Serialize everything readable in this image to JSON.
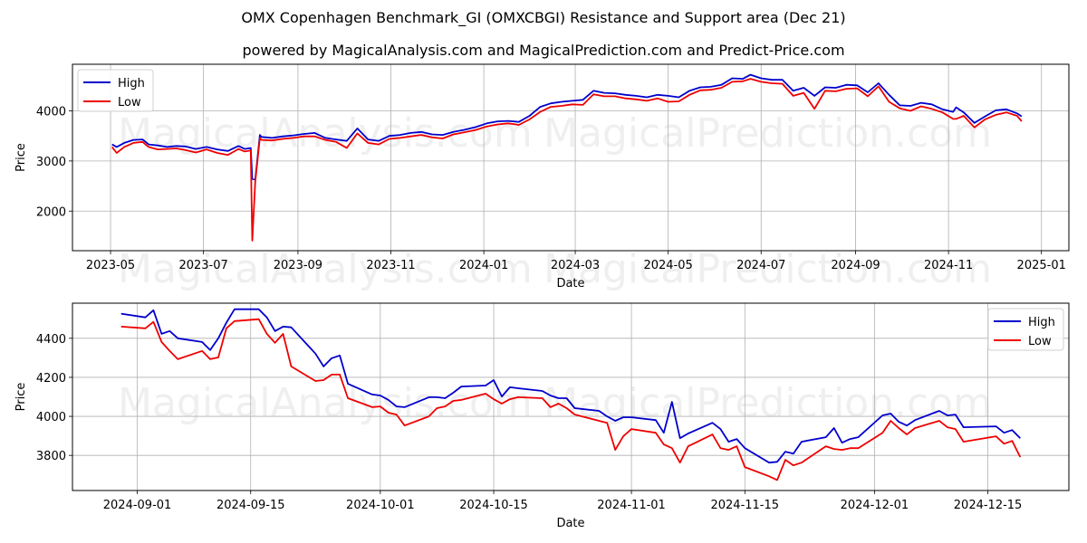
{
  "header": {
    "title": "OMX Copenhagen Benchmark_GI (OMXCBGI) Resistance and Support area (Dec 21)",
    "subtitle": "powered by MagicalAnalysis.com and MagicalPrediction.com and Predict-Price.com"
  },
  "watermarks": [
    "MagicalAnalysis.com",
    "MagicalPrediction.com"
  ],
  "colors": {
    "high": "#0000cc",
    "low": "#ee0000",
    "grid": "#b0b0b0"
  },
  "chart_data": [
    {
      "type": "line",
      "title": "",
      "xlabel": "Date",
      "ylabel": "Price",
      "ylim": [
        1210,
        4930
      ],
      "xlim": [
        "2023-04-06",
        "2025-01-19"
      ],
      "grid": true,
      "legend": {
        "placement": "top-left",
        "entries": [
          "High",
          "Low"
        ]
      },
      "x_ticks": [
        "2023-05",
        "2023-07",
        "2023-09",
        "2023-11",
        "2024-01",
        "2024-03",
        "2024-05",
        "2024-07",
        "2024-09",
        "2024-11",
        "2025-01"
      ],
      "y_ticks": [
        2000,
        3000,
        4000
      ],
      "x": [
        "2023-05-02",
        "2023-05-05",
        "2023-05-10",
        "2023-05-16",
        "2023-05-22",
        "2023-05-26",
        "2023-06-01",
        "2023-06-07",
        "2023-06-13",
        "2023-06-19",
        "2023-06-26",
        "2023-07-03",
        "2023-07-10",
        "2023-07-17",
        "2023-07-24",
        "2023-07-28",
        "2023-08-01",
        "2023-08-02",
        "2023-08-04",
        "2023-08-07",
        "2023-08-08",
        "2023-08-15",
        "2023-08-22",
        "2023-08-29",
        "2023-09-05",
        "2023-09-12",
        "2023-09-19",
        "2023-09-26",
        "2023-10-03",
        "2023-10-10",
        "2023-10-17",
        "2023-10-24",
        "2023-10-31",
        "2023-11-07",
        "2023-11-14",
        "2023-11-21",
        "2023-11-28",
        "2023-12-05",
        "2023-12-12",
        "2023-12-19",
        "2023-12-27",
        "2024-01-03",
        "2024-01-10",
        "2024-01-17",
        "2024-01-24",
        "2024-01-31",
        "2024-02-07",
        "2024-02-14",
        "2024-02-21",
        "2024-02-28",
        "2024-03-06",
        "2024-03-13",
        "2024-03-20",
        "2024-03-27",
        "2024-04-03",
        "2024-04-10",
        "2024-04-17",
        "2024-04-24",
        "2024-05-01",
        "2024-05-08",
        "2024-05-15",
        "2024-05-22",
        "2024-05-29",
        "2024-06-05",
        "2024-06-12",
        "2024-06-19",
        "2024-06-24",
        "2024-07-01",
        "2024-07-08",
        "2024-07-15",
        "2024-07-22",
        "2024-07-29",
        "2024-08-05",
        "2024-08-12",
        "2024-08-19",
        "2024-08-26",
        "2024-09-02",
        "2024-09-09",
        "2024-09-16",
        "2024-09-23",
        "2024-09-30",
        "2024-10-07",
        "2024-10-14",
        "2024-10-21",
        "2024-10-28",
        "2024-11-04",
        "2024-11-06",
        "2024-11-11",
        "2024-11-18",
        "2024-11-25",
        "2024-12-02",
        "2024-12-09",
        "2024-12-16",
        "2024-12-19"
      ],
      "series": [
        {
          "name": "High",
          "values": [
            3330,
            3280,
            3360,
            3420,
            3430,
            3330,
            3310,
            3280,
            3300,
            3290,
            3240,
            3280,
            3230,
            3200,
            3300,
            3240,
            3260,
            2640,
            2630,
            3520,
            3480,
            3460,
            3490,
            3510,
            3540,
            3560,
            3460,
            3430,
            3400,
            3650,
            3430,
            3400,
            3500,
            3520,
            3560,
            3580,
            3530,
            3520,
            3580,
            3620,
            3680,
            3750,
            3790,
            3800,
            3780,
            3900,
            4080,
            4150,
            4180,
            4200,
            4220,
            4400,
            4360,
            4350,
            4320,
            4300,
            4270,
            4320,
            4300,
            4270,
            4400,
            4470,
            4480,
            4520,
            4650,
            4640,
            4720,
            4650,
            4620,
            4620,
            4400,
            4460,
            4300,
            4470,
            4460,
            4520,
            4510,
            4370,
            4550,
            4320,
            4110,
            4100,
            4160,
            4130,
            4030,
            3980,
            4070,
            3970,
            3760,
            3890,
            4010,
            4030,
            3950,
            3890
          ]
        },
        {
          "name": "Low",
          "values": [
            3280,
            3160,
            3280,
            3360,
            3380,
            3280,
            3230,
            3240,
            3250,
            3220,
            3170,
            3230,
            3160,
            3120,
            3240,
            3190,
            3210,
            1410,
            2590,
            3460,
            3420,
            3410,
            3440,
            3460,
            3490,
            3490,
            3420,
            3380,
            3260,
            3550,
            3360,
            3330,
            3440,
            3460,
            3490,
            3520,
            3470,
            3450,
            3530,
            3570,
            3620,
            3690,
            3730,
            3750,
            3720,
            3830,
            3980,
            4080,
            4100,
            4130,
            4120,
            4330,
            4290,
            4290,
            4250,
            4230,
            4200,
            4250,
            4180,
            4190,
            4320,
            4410,
            4420,
            4460,
            4580,
            4590,
            4640,
            4580,
            4550,
            4540,
            4300,
            4360,
            4040,
            4400,
            4390,
            4440,
            4450,
            4290,
            4490,
            4180,
            4050,
            4000,
            4090,
            4040,
            3970,
            3840,
            3840,
            3900,
            3670,
            3830,
            3920,
            3970,
            3900,
            3790
          ]
        }
      ]
    },
    {
      "type": "line",
      "title": "",
      "xlabel": "Date",
      "ylabel": "Price",
      "ylim": [
        3620,
        4580
      ],
      "xlim": [
        "2024-08-24",
        "2024-12-25"
      ],
      "grid": true,
      "legend": {
        "placement": "top-right",
        "entries": [
          "High",
          "Low"
        ]
      },
      "x_ticks": [
        "2024-09-01",
        "2024-09-15",
        "2024-10-01",
        "2024-10-15",
        "2024-11-01",
        "2024-11-15",
        "2024-12-01",
        "2024-12-15"
      ],
      "y_ticks": [
        3800,
        4000,
        4200,
        4400
      ],
      "x": [
        "2024-08-30",
        "2024-09-02",
        "2024-09-03",
        "2024-09-04",
        "2024-09-05",
        "2024-09-06",
        "2024-09-09",
        "2024-09-10",
        "2024-09-11",
        "2024-09-12",
        "2024-09-13",
        "2024-09-16",
        "2024-09-17",
        "2024-09-18",
        "2024-09-19",
        "2024-09-20",
        "2024-09-23",
        "2024-09-24",
        "2024-09-25",
        "2024-09-26",
        "2024-09-27",
        "2024-09-30",
        "2024-10-01",
        "2024-10-02",
        "2024-10-03",
        "2024-10-04",
        "2024-10-07",
        "2024-10-08",
        "2024-10-09",
        "2024-10-10",
        "2024-10-11",
        "2024-10-14",
        "2024-10-15",
        "2024-10-16",
        "2024-10-17",
        "2024-10-18",
        "2024-10-21",
        "2024-10-22",
        "2024-10-23",
        "2024-10-24",
        "2024-10-25",
        "2024-10-28",
        "2024-10-29",
        "2024-10-30",
        "2024-10-31",
        "2024-11-01",
        "2024-11-04",
        "2024-11-05",
        "2024-11-06",
        "2024-11-07",
        "2024-11-08",
        "2024-11-11",
        "2024-11-12",
        "2024-11-13",
        "2024-11-14",
        "2024-11-15",
        "2024-11-18",
        "2024-11-19",
        "2024-11-20",
        "2024-11-21",
        "2024-11-22",
        "2024-11-25",
        "2024-11-26",
        "2024-11-27",
        "2024-11-28",
        "2024-11-29",
        "2024-12-02",
        "2024-12-03",
        "2024-12-04",
        "2024-12-05",
        "2024-12-06",
        "2024-12-09",
        "2024-12-10",
        "2024-12-11",
        "2024-12-12",
        "2024-12-16",
        "2024-12-17",
        "2024-12-18",
        "2024-12-19"
      ],
      "series": [
        {
          "name": "High",
          "values": [
            4526,
            4507,
            4544,
            4423,
            4437,
            4400,
            4381,
            4340,
            4400,
            4480,
            4549,
            4549,
            4507,
            4437,
            4460,
            4456,
            4321,
            4256,
            4298,
            4312,
            4167,
            4112,
            4107,
            4084,
            4051,
            4047,
            4098,
            4098,
            4093,
            4121,
            4153,
            4158,
            4186,
            4102,
            4149,
            4144,
            4130,
            4107,
            4093,
            4093,
            4042,
            4028,
            4000,
            3977,
            3995,
            3995,
            3981,
            3916,
            4074,
            3888,
            3912,
            3967,
            3935,
            3870,
            3884,
            3837,
            3763,
            3767,
            3819,
            3809,
            3870,
            3893,
            3940,
            3865,
            3884,
            3893,
            4005,
            4014,
            3972,
            3953,
            3981,
            4028,
            4005,
            4009,
            3944,
            3949,
            3916,
            3930,
            3888
          ]
        },
        {
          "name": "Low",
          "values": [
            4460,
            4451,
            4484,
            4381,
            4335,
            4293,
            4335,
            4293,
            4302,
            4451,
            4488,
            4498,
            4423,
            4377,
            4423,
            4256,
            4181,
            4186,
            4214,
            4214,
            4093,
            4047,
            4051,
            4019,
            4009,
            3953,
            4000,
            4042,
            4051,
            4079,
            4084,
            4116,
            4088,
            4065,
            4088,
            4098,
            4093,
            4047,
            4065,
            4042,
            4009,
            3977,
            3967,
            3828,
            3898,
            3935,
            3916,
            3856,
            3837,
            3763,
            3847,
            3907,
            3837,
            3828,
            3847,
            3740,
            3693,
            3674,
            3777,
            3749,
            3763,
            3847,
            3833,
            3828,
            3837,
            3837,
            3916,
            3977,
            3940,
            3907,
            3940,
            3977,
            3944,
            3935,
            3870,
            3898,
            3860,
            3874,
            3791
          ]
        }
      ]
    }
  ]
}
